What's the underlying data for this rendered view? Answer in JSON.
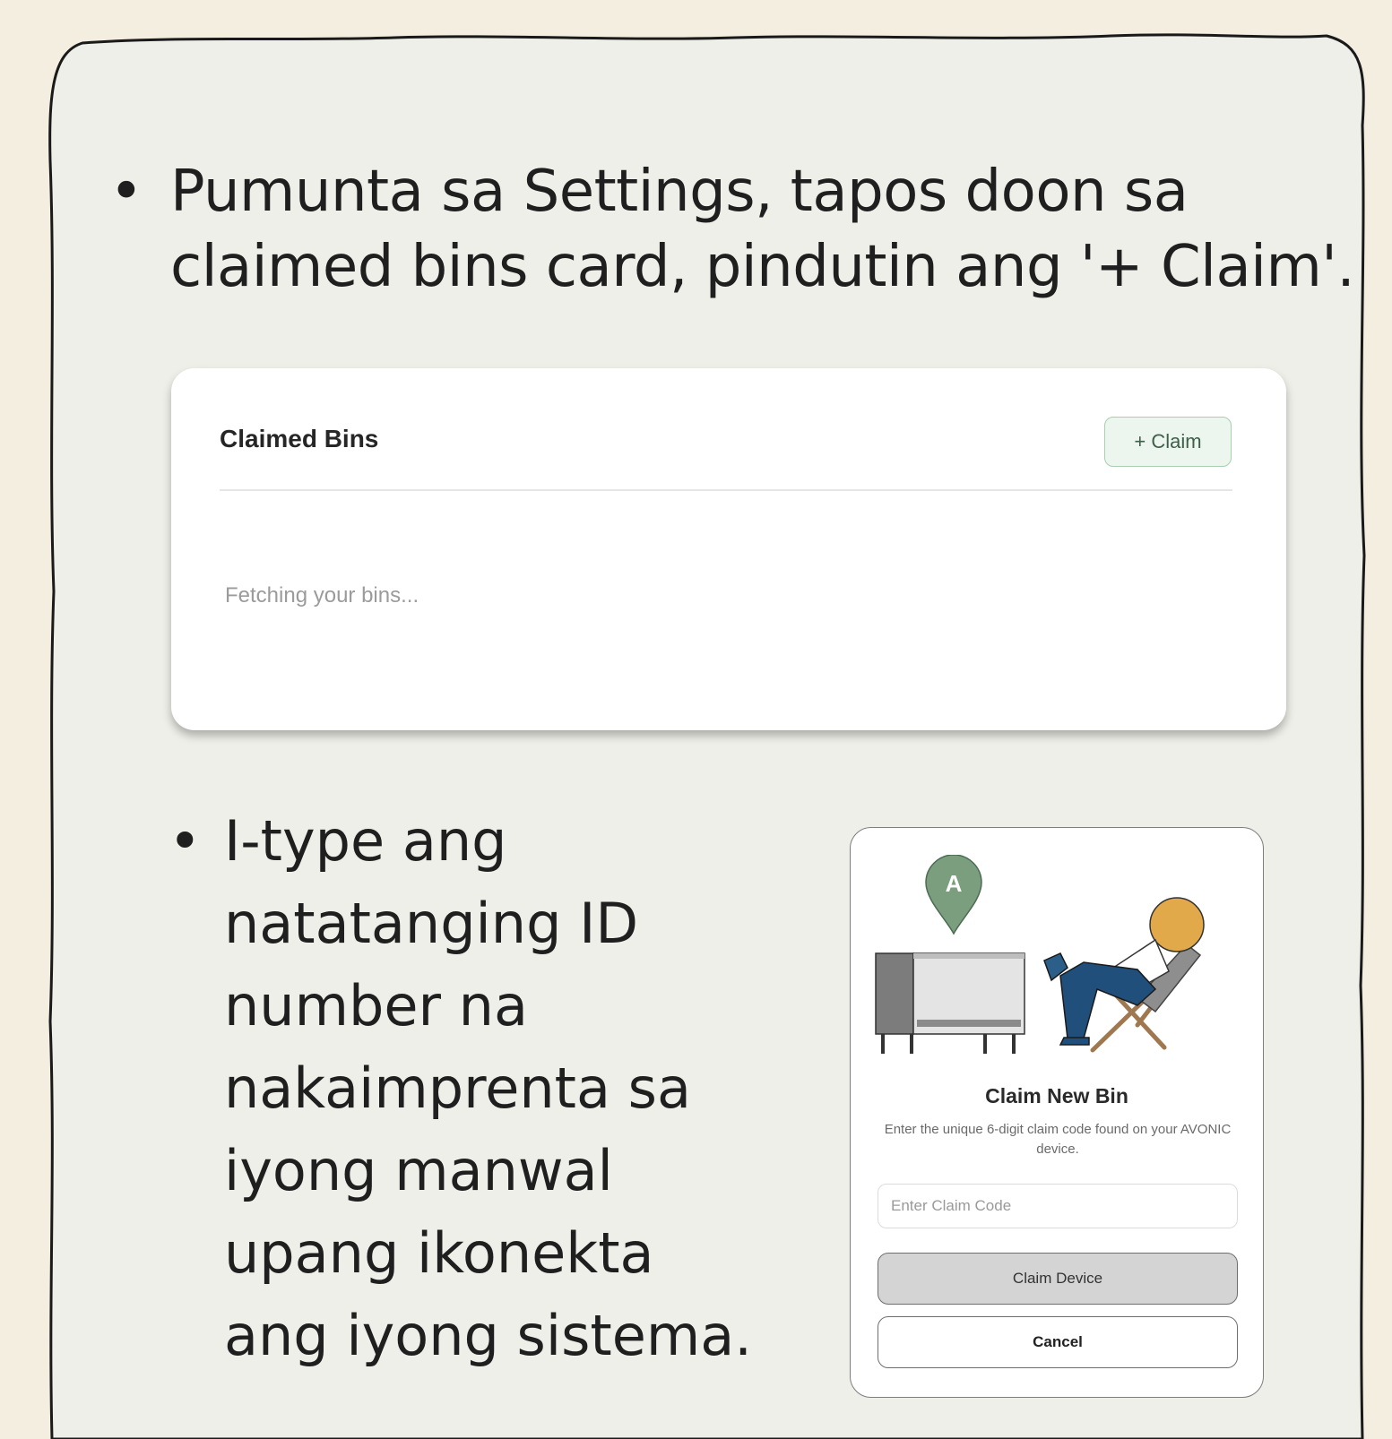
{
  "colors": {
    "page_background": "#f4eee0",
    "sheet_background": "#efefe9",
    "claim_button_bg": "#ecf6ef",
    "claim_button_border": "#a7cfb0",
    "pin_green": "#7a9e7e",
    "primary_button_bg": "#d4d4d4"
  },
  "instructions": {
    "step1": {
      "bullet": "•",
      "text": "Pumunta sa Settings, tapos doon sa claimed bins card, pindutin ang '+ Claim'."
    },
    "step2": {
      "bullet": "•",
      "lines": [
        "I-type ang",
        "natatanging ID",
        "number na",
        "nakaimprenta sa",
        "iyong manwal",
        "upang ikonekta",
        "ang iyong sistema."
      ]
    }
  },
  "claimed_bins_card": {
    "title": "Claimed Bins",
    "claim_button_label": "+ Claim",
    "loading_text": "Fetching your bins..."
  },
  "claim_modal": {
    "pin_letter": "A",
    "title": "Claim New Bin",
    "description": "Enter the unique 6-digit claim code found on your AVONIC device.",
    "input_placeholder": "Enter Claim Code",
    "input_value": "",
    "submit_label": "Claim Device",
    "cancel_label": "Cancel",
    "illustration_icon": "person-relaxing-beside-bin-illustration"
  }
}
